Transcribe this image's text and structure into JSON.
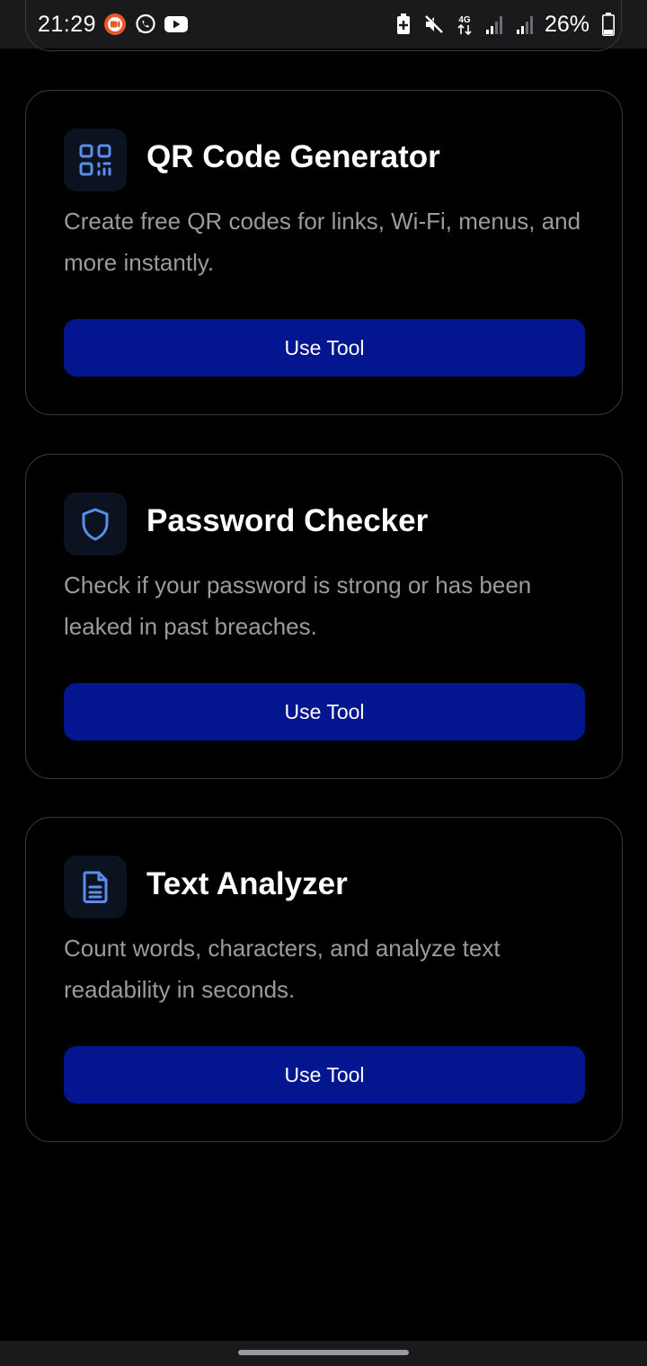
{
  "status_bar": {
    "time": "21:29",
    "battery_percent": "26%",
    "network_label": "4G",
    "left_icons": [
      "screen-recorder-icon",
      "whatsapp-icon",
      "youtube-icon"
    ],
    "right_icons": [
      "battery-saver-icon",
      "mute-icon",
      "network-4g-icon",
      "signal-icon",
      "signal-icon",
      "battery-icon"
    ]
  },
  "colors": {
    "background": "#000000",
    "card_border": "#3a3a3d",
    "button_bg": "#03158f",
    "icon_accent": "#5b8def",
    "description_text": "#9a9aa0"
  },
  "tools": [
    {
      "icon": "qr-code-icon",
      "title": "QR Code Generator",
      "description": "Create free QR codes for links, Wi-Fi, menus, and more instantly.",
      "button_label": "Use Tool"
    },
    {
      "icon": "shield-icon",
      "title": "Password Checker",
      "description": "Check if your password is strong or has been leaked in past breaches.",
      "button_label": "Use Tool"
    },
    {
      "icon": "document-icon",
      "title": "Text Analyzer",
      "description": "Count words, characters, and analyze text readability in seconds.",
      "button_label": "Use Tool"
    }
  ]
}
